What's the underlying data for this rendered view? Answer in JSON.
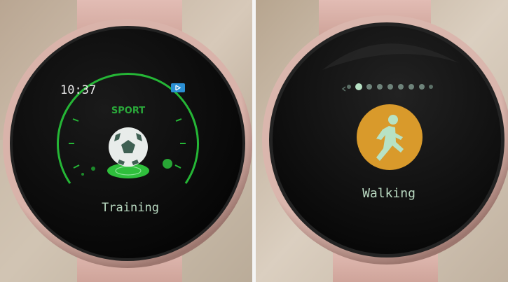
{
  "left_watch": {
    "time": "10:37",
    "header": "SPORT",
    "activity_label": "Training",
    "icon": "soccer-ball-icon",
    "status_icon": "bluetooth-icon",
    "accent_color": "#25b636"
  },
  "right_watch": {
    "activity_label": "Walking",
    "icon": "walking-person-icon",
    "page_indicator": {
      "count": 8,
      "active_index": 1
    },
    "icon_bg_color": "#d99a2b",
    "icon_fg_color": "#b7e2c4"
  }
}
